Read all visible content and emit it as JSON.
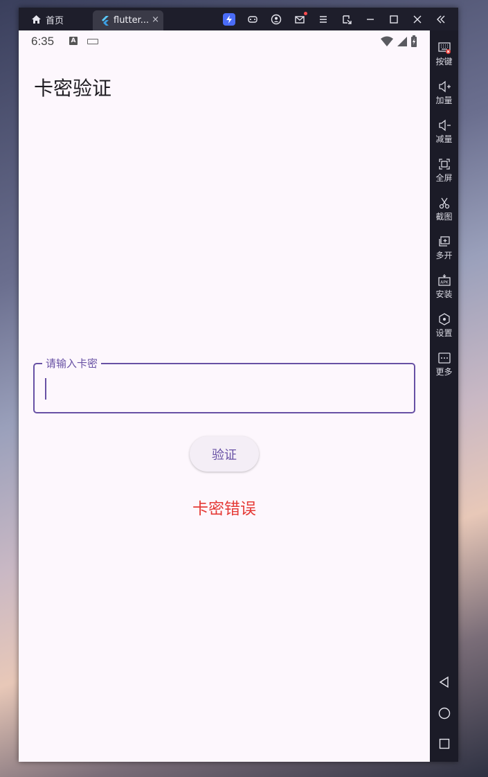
{
  "titlebar": {
    "home_tab_label": "首页",
    "app_tab_label": "flutter...",
    "close_glyph": "×",
    "icons": [
      "bolt-icon",
      "gamepad-icon",
      "account-icon",
      "mail-icon",
      "menu-icon",
      "screenshot-icon",
      "minimize-icon",
      "maximize-icon",
      "close-icon",
      "collapse-icon"
    ]
  },
  "statusbar": {
    "time": "6:35"
  },
  "app": {
    "title": "卡密验证",
    "input_label": "请输入卡密",
    "verify_button": "验证",
    "error_message": "卡密错误"
  },
  "sidebar": {
    "items": [
      {
        "label": "按键",
        "icon": "keyboard-icon"
      },
      {
        "label": "加量",
        "icon": "volume-up-icon"
      },
      {
        "label": "减量",
        "icon": "volume-down-icon"
      },
      {
        "label": "全屏",
        "icon": "fullscreen-icon"
      },
      {
        "label": "截图",
        "icon": "scissors-icon"
      },
      {
        "label": "多开",
        "icon": "multi-instance-icon"
      },
      {
        "label": "安装",
        "icon": "apk-install-icon"
      },
      {
        "label": "设置",
        "icon": "settings-icon"
      },
      {
        "label": "更多",
        "icon": "more-icon"
      }
    ],
    "nav": [
      "back-icon",
      "home-circle-icon",
      "recents-icon"
    ]
  },
  "colors": {
    "accent": "#6750a4",
    "error": "#e53935",
    "screen_bg": "#fdf7fd",
    "chrome_bg": "#1b1b27"
  }
}
